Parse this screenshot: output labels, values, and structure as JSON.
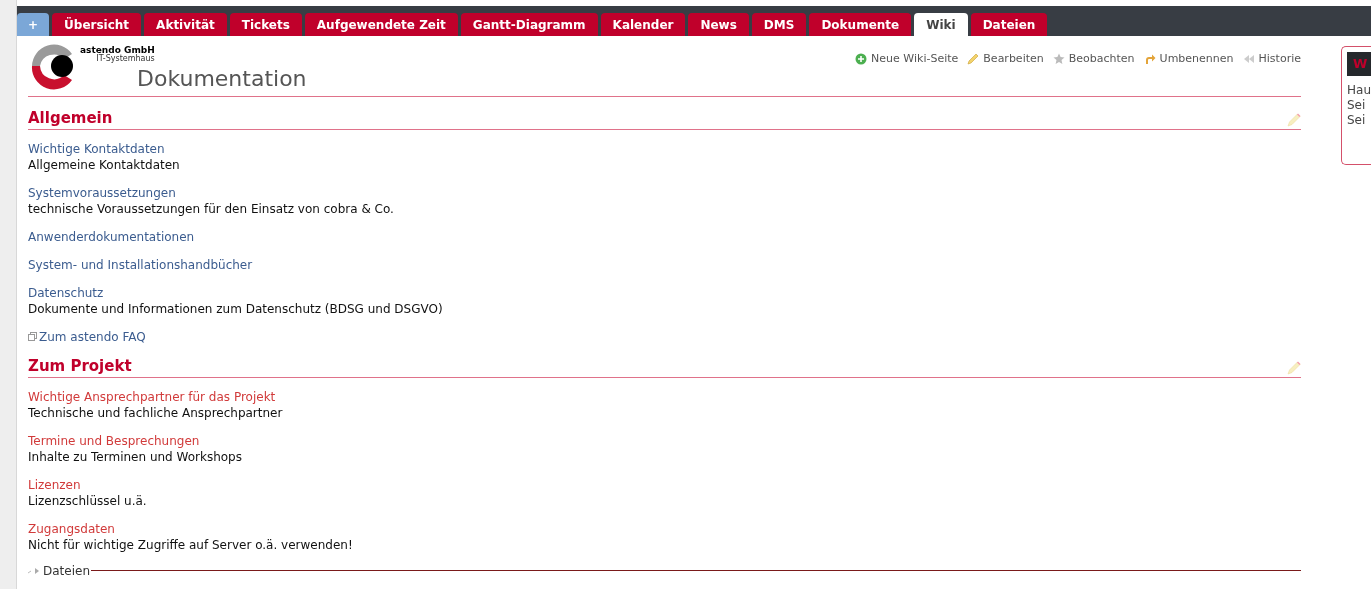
{
  "tabs": [
    {
      "label": "+",
      "kind": "new",
      "selected": false
    },
    {
      "label": "Übersicht",
      "kind": "tab",
      "selected": false
    },
    {
      "label": "Aktivität",
      "kind": "tab",
      "selected": false
    },
    {
      "label": "Tickets",
      "kind": "tab",
      "selected": false
    },
    {
      "label": "Aufgewendete Zeit",
      "kind": "tab",
      "selected": false
    },
    {
      "label": "Gantt-Diagramm",
      "kind": "tab",
      "selected": false
    },
    {
      "label": "Kalender",
      "kind": "tab",
      "selected": false
    },
    {
      "label": "News",
      "kind": "tab",
      "selected": false
    },
    {
      "label": "DMS",
      "kind": "tab",
      "selected": false
    },
    {
      "label": "Dokumente",
      "kind": "tab",
      "selected": false
    },
    {
      "label": "Wiki",
      "kind": "tab",
      "selected": true
    },
    {
      "label": "Dateien",
      "kind": "tab",
      "selected": false
    }
  ],
  "logo": {
    "name": "astendo GmbH",
    "tagline": "IT-Systemhaus"
  },
  "page_title": "Dokumentation",
  "actions": [
    {
      "label": "Neue Wiki-Seite",
      "kind": "add"
    },
    {
      "label": "Bearbeiten",
      "kind": "edit"
    },
    {
      "label": "Beobachten",
      "kind": "watch"
    },
    {
      "label": "Umbenennen",
      "kind": "rename"
    },
    {
      "label": "Historie",
      "kind": "history"
    }
  ],
  "sections": [
    {
      "title": "Allgemein",
      "items": [
        {
          "link": "Wichtige Kontaktdaten",
          "exists": true,
          "description": "Allgemeine Kontaktdaten"
        },
        {
          "link": "Systemvoraussetzungen",
          "exists": true,
          "description": "technische Voraussetzungen für den Einsatz von cobra & Co."
        },
        {
          "link": "Anwenderdokumentationen",
          "exists": true
        },
        {
          "link": "System- und Installationshandbücher",
          "exists": true
        },
        {
          "link": "Datenschutz",
          "exists": true,
          "description": "Dokumente und Informationen zum Datenschutz (BDSG und DSGVO)"
        }
      ],
      "external_link": "Zum astendo FAQ"
    },
    {
      "title": "Zum Projekt",
      "items": [
        {
          "link": "Wichtige Ansprechpartner für das Projekt",
          "exists": false,
          "description": "Technische und fachliche Ansprechpartner"
        },
        {
          "link": "Termine und Besprechungen",
          "exists": false,
          "description": "Inhalte zu Terminen und Workshops"
        },
        {
          "link": "Lizenzen",
          "exists": false,
          "description": "Lizenzschlüssel u.ä."
        },
        {
          "link": "Zugangsdaten",
          "exists": false,
          "description": "Nicht für wichtige Zugriffe auf Server o.ä. verwenden!"
        }
      ]
    }
  ],
  "files": {
    "label": "Dateien",
    "expanded": false
  },
  "sidebar": {
    "title": "W",
    "items": [
      "Hau",
      "Sei",
      "Sei"
    ]
  }
}
